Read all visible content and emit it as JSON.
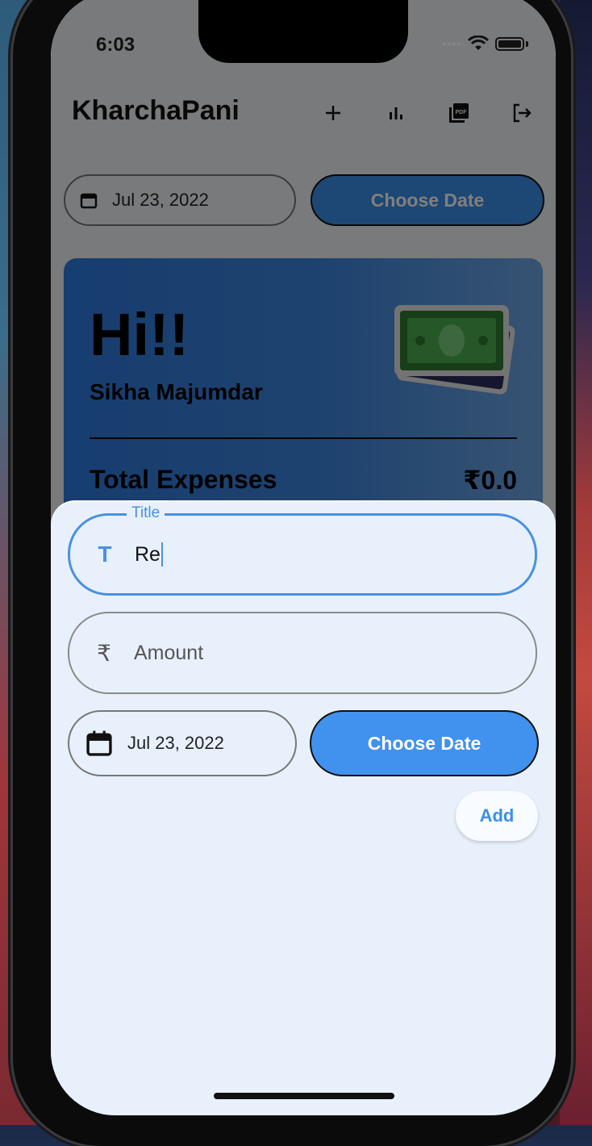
{
  "status": {
    "time": "6:03"
  },
  "appbar": {
    "title": "KharchaPani",
    "actions": [
      {
        "icon": "plus-icon"
      },
      {
        "icon": "bar-chart-icon"
      },
      {
        "icon": "pdf-icon"
      },
      {
        "icon": "logout-icon"
      }
    ]
  },
  "date_row": {
    "date": "Jul 23, 2022",
    "button": "Choose Date"
  },
  "summary": {
    "greeting": "Hi!!",
    "user_name": "Sikha Majumdar",
    "total_label": "Total Expenses",
    "total_value": "₹0.0"
  },
  "sheet": {
    "title_field": {
      "label": "Title",
      "value": "Re",
      "icon": "text-t-icon"
    },
    "amount_field": {
      "placeholder": "Amount",
      "icon": "rupee-icon"
    },
    "date": "Jul 23, 2022",
    "date_button": "Choose Date",
    "add_button": "Add"
  },
  "colors": {
    "accent": "#3b8fe8",
    "sheet_bg": "#e8f1fb"
  }
}
